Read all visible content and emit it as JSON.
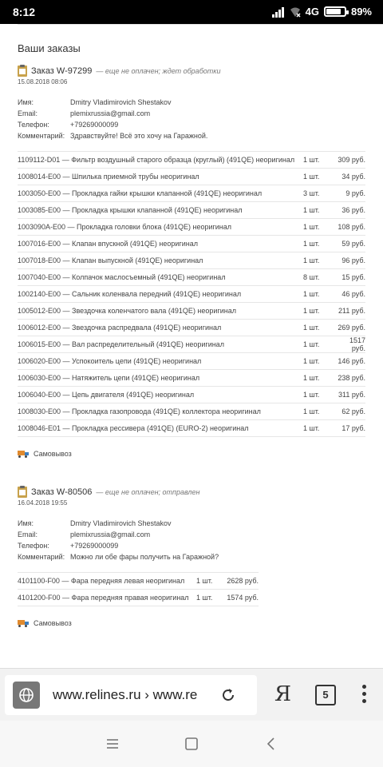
{
  "status": {
    "time": "8:12",
    "network": "4G",
    "battery": "89%",
    "battery_level": 0.89
  },
  "page": {
    "title": "Ваши заказы"
  },
  "orders": [
    {
      "number": "Заказ W-97299",
      "status": "— еще не оплачен; ждет обработки",
      "date": "15.08.2018 08:06",
      "info": [
        {
          "label": "Имя:",
          "value": "Dmitry Vladimirovich Shestakov"
        },
        {
          "label": "Email:",
          "value": "plemixrussia@gmail.com"
        },
        {
          "label": "Телефон:",
          "value": "+79269000099"
        },
        {
          "label": "Комментарий:",
          "value": "Здравствуйте! Всё это хочу на Гаражной."
        }
      ],
      "items": [
        {
          "name": "1109112-D01 — Фильтр воздушный старого образца (круглый) (491QE) неоригинал",
          "qty": "1 шт.",
          "price": "309 руб."
        },
        {
          "name": "1008014-E00 — Шпилька приемной трубы неоригинал",
          "qty": "1 шт.",
          "price": "34 руб."
        },
        {
          "name": "1003050-E00 — Прокладка гайки крышки клапанной (491QE) неоригинал",
          "qty": "3 шт.",
          "price": "9 руб."
        },
        {
          "name": "1003085-E00 — Прокладка крышки клапанной (491QE) неоригинал",
          "qty": "1 шт.",
          "price": "36 руб."
        },
        {
          "name": "1003090A-E00 — Прокладка головки блока (491QE) неоригинал",
          "qty": "1 шт.",
          "price": "108 руб."
        },
        {
          "name": "1007016-E00 — Клапан впускной (491QE) неоригинал",
          "qty": "1 шт.",
          "price": "59 руб."
        },
        {
          "name": "1007018-E00 — Клапан выпускной (491QE) неоригинал",
          "qty": "1 шт.",
          "price": "96 руб."
        },
        {
          "name": "1007040-E00 — Колпачок маслосъемный (491QE) неоригинал",
          "qty": "8 шт.",
          "price": "15 руб."
        },
        {
          "name": "1002140-E00 — Сальник коленвала передний (491QE) неоригинал",
          "qty": "1 шт.",
          "price": "46 руб."
        },
        {
          "name": "1005012-E00 — Звездочка коленчатого вала (491QE) неоригинал",
          "qty": "1 шт.",
          "price": "211 руб."
        },
        {
          "name": "1006012-E00 — Звездочка распредвала (491QE) неоригинал",
          "qty": "1 шт.",
          "price": "269 руб."
        },
        {
          "name": "1006015-E00 — Вал распределительный (491QE) неоригинал",
          "qty": "1 шт.",
          "price": "1517 руб."
        },
        {
          "name": "1006020-E00 — Успокоитель цепи (491QE) неоригинал",
          "qty": "1 шт.",
          "price": "146 руб."
        },
        {
          "name": "1006030-E00 — Натяжитель цепи (491QE) неоригинал",
          "qty": "1 шт.",
          "price": "238 руб."
        },
        {
          "name": "1006040-E00 — Цепь двигателя (491QE) неоригинал",
          "qty": "1 шт.",
          "price": "311 руб."
        },
        {
          "name": "1008030-E00 — Прокладка газопровода (491QE) коллектора неоригинал",
          "qty": "1 шт.",
          "price": "62 руб."
        },
        {
          "name": "1008046-E01 — Прокладка рессивера (491QE) (EURO-2) неоригинал",
          "qty": "1 шт.",
          "price": "17 руб."
        }
      ],
      "delivery": "Самовывоз"
    },
    {
      "number": "Заказ W-80506",
      "status": "— еще не оплачен; отправлен",
      "date": "16.04.2018 19:55",
      "info": [
        {
          "label": "Имя:",
          "value": "Dmitry Vladimirovich Shestakov"
        },
        {
          "label": "Email:",
          "value": "plemixrussia@gmail.com"
        },
        {
          "label": "Телефон:",
          "value": "+79269000099"
        },
        {
          "label": "Комментарий:",
          "value": "Можно ли обе фары получить на Гаражной?"
        }
      ],
      "items": [
        {
          "name": "4101100-F00 — Фара передняя левая неоригинал",
          "qty": "1 шт.",
          "price": "2628 руб."
        },
        {
          "name": "4101200-F00 — Фара передняя правая неоригинал",
          "qty": "1 шт.",
          "price": "1574 руб."
        }
      ],
      "delivery": "Самовывоз"
    }
  ],
  "browser": {
    "url": "www.relines.ru › www.re",
    "tab_count": "5",
    "yandex_label": "Я"
  }
}
